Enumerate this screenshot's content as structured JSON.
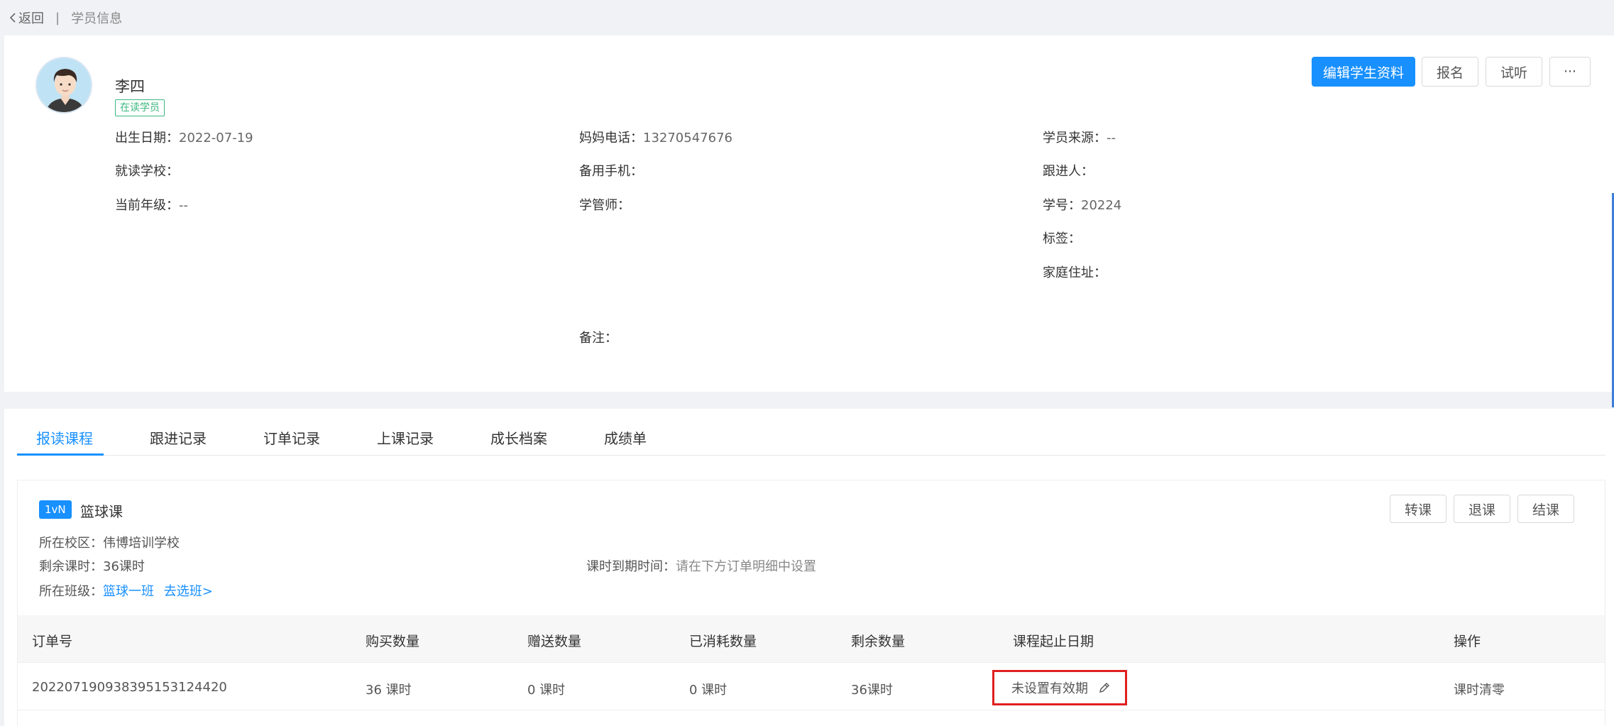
{
  "topbar": {
    "back_label": "返回",
    "separator": "|",
    "page_title": "学员信息"
  },
  "profile": {
    "name": "李四",
    "status": "在读学员",
    "fields": {
      "birth_date": {
        "label": "出生日期：",
        "value": "2022-07-19"
      },
      "mother_phone": {
        "label": "妈妈电话：",
        "value": "13270547676"
      },
      "source": {
        "label": "学员来源：",
        "value": "--"
      },
      "school": {
        "label": "就读学校：",
        "value": ""
      },
      "backup_phone": {
        "label": "备用手机：",
        "value": ""
      },
      "follower": {
        "label": "跟进人：",
        "value": ""
      },
      "grade": {
        "label": "当前年级：",
        "value": "--"
      },
      "manager": {
        "label": "学管师：",
        "value": ""
      },
      "student_no": {
        "label": "学号：",
        "value": "20224"
      },
      "tags": {
        "label": "标签：",
        "value": ""
      },
      "address": {
        "label": "家庭住址：",
        "value": ""
      },
      "remark": {
        "label": "备注：",
        "value": ""
      }
    },
    "actions": {
      "edit": "编辑学生资料",
      "enroll": "报名",
      "trial": "试听",
      "more": "···"
    }
  },
  "tabs": [
    "报读课程",
    "跟进记录",
    "订单记录",
    "上课记录",
    "成长档案",
    "成绩单"
  ],
  "active_tab": "报读课程",
  "course": {
    "badge": "1vN",
    "name": "篮球课",
    "campus": {
      "label": "所在校区：",
      "value": "伟博培训学校"
    },
    "remaining": {
      "label": "剩余课时：",
      "value": "36课时"
    },
    "expiry": {
      "label": "课时到期时间：",
      "value": "请在下方订单明细中设置"
    },
    "class": {
      "label": "所在班级：",
      "value": "篮球一班",
      "link": "去选班>"
    },
    "actions": {
      "transfer": "转课",
      "refund": "退课",
      "finish": "结课"
    }
  },
  "orders": {
    "columns": [
      "订单号",
      "购买数量",
      "赠送数量",
      "已消耗数量",
      "剩余数量",
      "课程起止日期",
      "操作"
    ],
    "rows": [
      {
        "order_no": "20220719093839515312442​0",
        "bought": "36 课时",
        "gift": "0 课时",
        "consumed": "0 课时",
        "remaining": "36课时",
        "validity": "未设置有效期",
        "action": "课时清零"
      }
    ]
  },
  "colors": {
    "primary": "#1890ff",
    "status_green": "#3bb77e",
    "highlight_red": "#e02020"
  }
}
